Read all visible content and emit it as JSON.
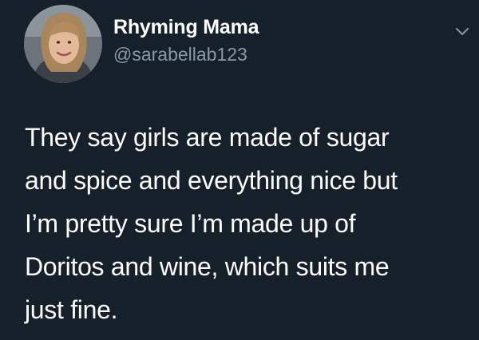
{
  "user": {
    "display_name": "Rhyming Mama",
    "handle": "@sarabellab123",
    "avatar_icon": "profile-photo"
  },
  "menu": {
    "icon": "chevron-down-icon"
  },
  "tweet": {
    "lines": [
      "They say girls are made of sugar",
      "and spice and everything nice but",
      "I’m pretty sure I’m made up of",
      "Doritos and wine, which suits me",
      "just fine."
    ]
  },
  "colors": {
    "background": "#15202b",
    "primary_text": "#ffffff",
    "secondary_text": "#8899a6"
  }
}
